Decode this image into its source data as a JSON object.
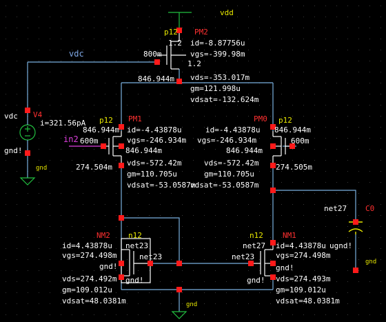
{
  "colors": {
    "wire": "#7ab0e0",
    "device": "#ffffff",
    "pin": "#ff2020",
    "supply": "#22c040",
    "param": "#ffffff",
    "instance": "#ff3030",
    "model": "#e8e800",
    "netlabel": "#7fa8e6",
    "input": "#e040e0",
    "cap": "#e8e800",
    "background": "#000000"
  },
  "labels": {
    "vdd": "vdd",
    "vdc": "vdc",
    "vdc_src": "vdc",
    "gnd_src": "gnd!",
    "gnd_sym": "gnd",
    "v4": "V4",
    "v4_i": "i=321.56pA",
    "pm2_model": "p12",
    "pm2_name": "PM2",
    "pm2_w": "1.2",
    "pm2_l": "1.2",
    "pm2_gate": "800m",
    "pm2_id": "id=-8.87756u",
    "pm2_vgs": "vgs=-399.98m",
    "pm2_vds": "vds=-353.017m",
    "pm2_gm": "gm=121.998u",
    "pm2_vdsat": "vdsat=-132.624m",
    "pm2_drain": "846.944m",
    "pm1_model": "p12",
    "pm1_name": "PM1",
    "pm1_src": "846.944m",
    "pm1_gate": "600m",
    "pm1_bulk": "846.944m",
    "pm1_drain": "274.504m",
    "in2": "in2",
    "pm1_id": "id=-4.43878u",
    "pm1_vgs": "vgs=-246.934m",
    "pm1_vds": "vds=-572.42m",
    "pm1_gm": "gm=110.705u",
    "pm1_vdsat": "vdsat=-53.0587m",
    "pm0_model": "p12",
    "pm0_name": "PM0",
    "pm0_src": "846.944m",
    "pm0_gate": "600m",
    "pm0_bulk": "846.944m",
    "pm0_drain": "274.505m",
    "pm0_id": "id=-4.43878u",
    "pm0_vgs": "vgs=-246.934m",
    "pm0_vds": "vds=-572.42m",
    "pm0_gm": "gm=110.705u",
    "pm0_vdsat": "vdsat=-53.0587m",
    "nm2_name": "NM2",
    "nm2_model": "n12",
    "nm2_net": "net23",
    "nm2_gate": "net23",
    "nm2_gnd": "gnd!",
    "nm2_gnd2": "gnd!",
    "nm2_id": "id=4.43878u",
    "nm2_vgs": "vgs=274.498m",
    "nm2_vds": "vds=274.492m",
    "nm2_gm": "gm=109.012u",
    "nm2_vdsat": "vdsat=48.0381m",
    "nm1_name": "NM1",
    "nm1_model": "n12",
    "nm1_net": "net27",
    "nm1_gate": "net23",
    "nm1_gnd": "gnd!",
    "nm1_gnd2": "gnd!",
    "nm1_ugnd": "ugnd!",
    "nm1_id": "id=4.43878u",
    "nm1_vgs": "vgs=274.498m",
    "nm1_vds": "vds=274.493m",
    "nm1_gm": "gm=109.012u",
    "nm1_vdsat": "vdsat=48.0381m",
    "net27": "net27",
    "c0": "C0",
    "cgnd": "gnd",
    "bgnd": "gnd"
  }
}
